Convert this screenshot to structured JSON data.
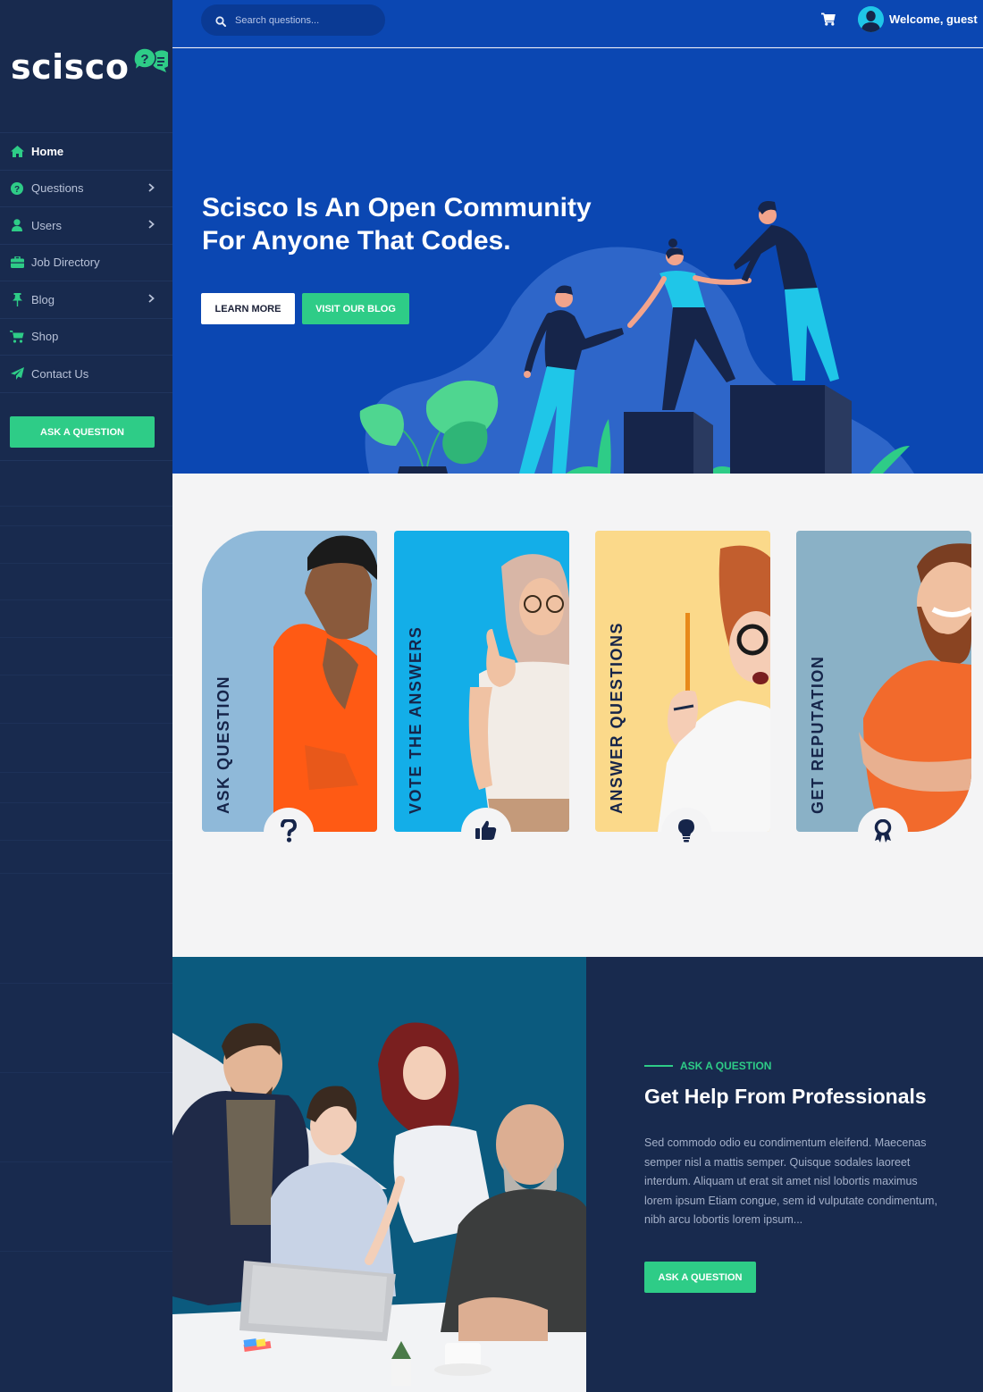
{
  "brand": {
    "name": "scisco",
    "accent": "#2ecc87",
    "sidebar_bg": "#182a4e",
    "hero_bg": "#0b47b2"
  },
  "sidebar": {
    "items": [
      {
        "label": "Home",
        "icon": "home-icon",
        "active": true,
        "has_submenu": false
      },
      {
        "label": "Questions",
        "icon": "question-circle-icon",
        "active": false,
        "has_submenu": true
      },
      {
        "label": "Users",
        "icon": "user-icon",
        "active": false,
        "has_submenu": true
      },
      {
        "label": "Job Directory",
        "icon": "briefcase-icon",
        "active": false,
        "has_submenu": false
      },
      {
        "label": "Blog",
        "icon": "pin-icon",
        "active": false,
        "has_submenu": true
      },
      {
        "label": "Shop",
        "icon": "cart-icon",
        "active": false,
        "has_submenu": false
      },
      {
        "label": "Contact Us",
        "icon": "paper-plane-icon",
        "active": false,
        "has_submenu": false
      }
    ],
    "cta_label": "ASK A QUESTION"
  },
  "topbar": {
    "search_placeholder": "Search questions...",
    "cart_icon": "cart-icon",
    "welcome_text": "Welcome, guest"
  },
  "hero": {
    "title": "Scisco Is An Open Community For Anyone That Codes.",
    "learn_more_label": "LEARN MORE",
    "blog_label": "VISIT OUR BLOG"
  },
  "features": [
    {
      "label": "ASK QUESTION",
      "icon": "question-mark-icon"
    },
    {
      "label": "VOTE THE ANSWERS",
      "icon": "thumbs-up-icon"
    },
    {
      "label": "ANSWER QUESTIONS",
      "icon": "lightbulb-icon"
    },
    {
      "label": "GET REPUTATION",
      "icon": "award-icon"
    }
  ],
  "help_section": {
    "eyebrow": "ASK A QUESTION",
    "title": "Get Help From Professionals",
    "description": "Sed commodo odio eu condimentum eleifend. Maecenas semper nisl a mattis semper. Quisque sodales laoreet interdum. Aliquam ut erat sit amet nisl lobortis maximus lorem ipsum Etiam congue, sem id vulputate condimentum, nibh arcu lobortis lorem ipsum...",
    "cta_label": "ASK A QUESTION"
  }
}
